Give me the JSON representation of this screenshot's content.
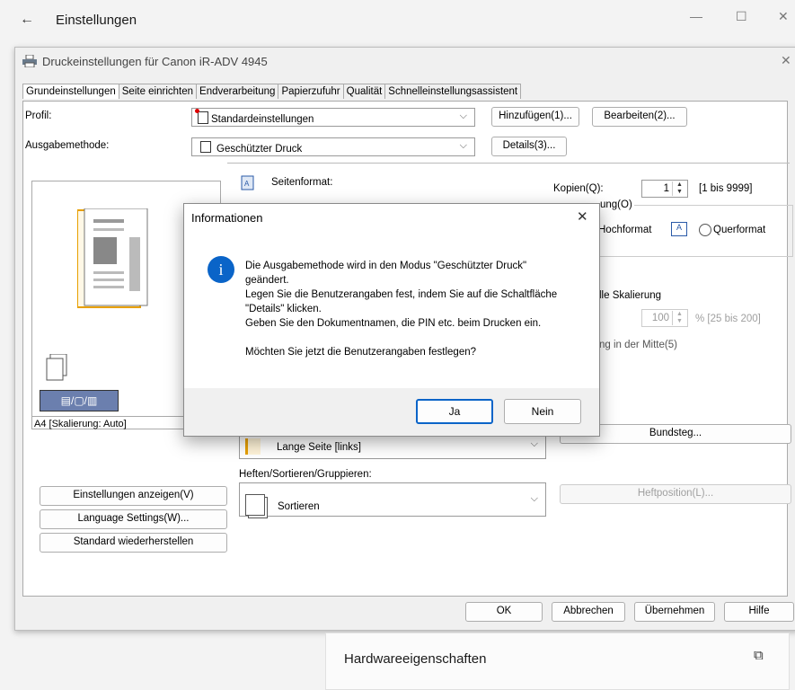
{
  "settings": {
    "title": "Einstellungen"
  },
  "driver": {
    "title": "Druckeinstellungen für Canon iR-ADV 4945",
    "tabs": [
      "Grundeinstellungen",
      "Seite einrichten",
      "Endverarbeitung",
      "Papierzufuhr",
      "Qualität",
      "Schnelleinstellungsassistent"
    ],
    "profile_label": "Profil:",
    "profile_value": "Standardeinstellungen",
    "add_button": "Hinzufügen(1)...",
    "edit_button": "Bearbeiten(2)...",
    "output_label": "Ausgabemethode:",
    "output_value": "Geschützter Druck",
    "details_button": "Details(3)...",
    "page_size_label": "Seitenformat:",
    "copies_label": "Kopien(Q):",
    "copies_value": "1",
    "copies_range": "[1 bis 9999]",
    "orientation_label": "ung(O)",
    "portrait": "Hochformat",
    "landscape": "Querformat",
    "scaling_label": "lle Skalierung",
    "scaling_value": "100",
    "scaling_range": "% [25 bis 200]",
    "center_label": "ng in der Mitte(5)",
    "preview_caption": "A4 [Skalierung: Auto]",
    "binding_value": "Lange Seite [links]",
    "gutter_button": "Bundsteg...",
    "staple_label": "Heften/Sortieren/Gruppieren:",
    "staple_value": "Sortieren",
    "staple_pos_button": "Heftposition(L)...",
    "view_settings_button": "Einstellungen anzeigen(V)",
    "language_button": "Language Settings(W)...",
    "restore_button": "Standard wiederherstellen",
    "ok": "OK",
    "cancel": "Abbrechen",
    "apply": "Übernehmen",
    "help": "Hilfe"
  },
  "dialog": {
    "title": "Informationen",
    "line1": "Die Ausgabemethode wird in den Modus \"Geschützter Druck\"",
    "line2": "geändert.",
    "line3": "Legen Sie die Benutzerangaben fest, indem Sie auf die Schaltfläche",
    "line4": "\"Details\" klicken.",
    "line5": "Geben Sie den Dokumentnamen, die PIN etc. beim Drucken ein.",
    "question": "Möchten Sie jetzt die Benutzerangaben festlegen?",
    "yes": "Ja",
    "no": "Nein"
  },
  "hardware": {
    "label": "Hardwareeigenschaften"
  }
}
